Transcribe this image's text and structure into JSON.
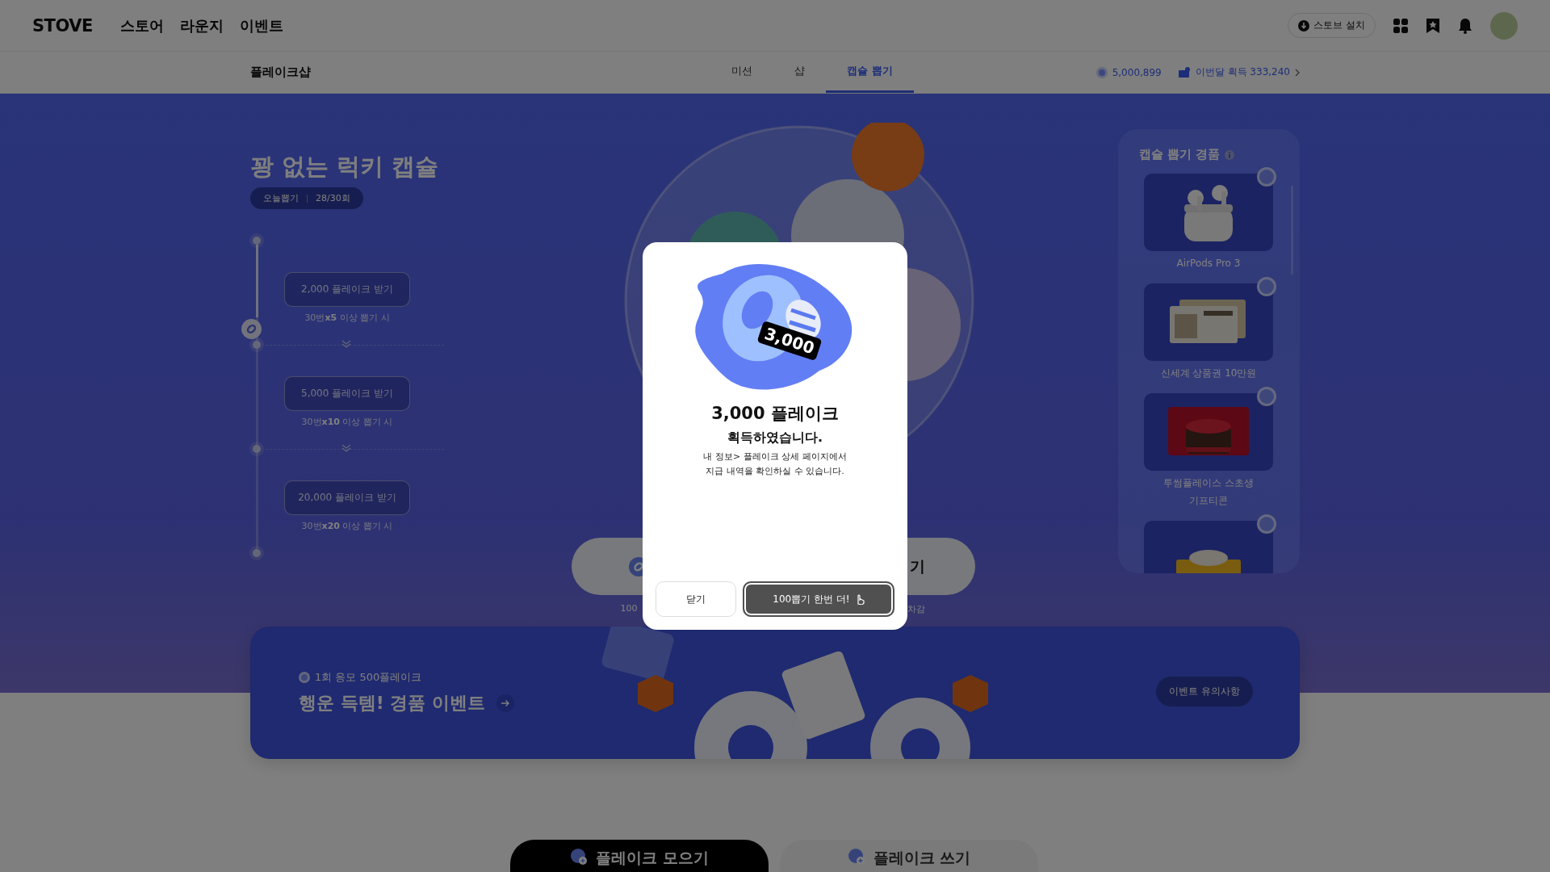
{
  "top_nav": {
    "logo": "STOVE",
    "menu": [
      "스토어",
      "라운지",
      "이벤트"
    ],
    "install_button": "스토브 설치"
  },
  "sub_nav": {
    "title": "플레이크샵",
    "tabs": [
      {
        "label": "미션",
        "selected": false
      },
      {
        "label": "샵",
        "selected": false
      },
      {
        "label": "캡슐 뽑기",
        "selected": true
      }
    ],
    "balance": "5,000,899",
    "monthly": "이번달 획득 333,240"
  },
  "hero": {
    "title": "꽝 없는 럭키 캡슐",
    "today_label": "오늘뽑기",
    "today_count": "28/30회",
    "timeline": {
      "level": 0.26,
      "milestones": [
        {
          "reward": "2,000 플레이크 받기",
          "condition": "30번**x5** 이상 뽑기 시"
        },
        {
          "reward": "5,000 플레이크 받기",
          "condition": "30번**x10** 이상 뽑기 시"
        },
        {
          "reward": "20,000 플레이크 받기",
          "condition": "30번**x20** 이상 뽑기 시"
        }
      ]
    },
    "pull_buttons": [
      {
        "caption": "100"
      },
      {
        "label": "기",
        "caption": "차감"
      }
    ]
  },
  "prizes": {
    "title": "캡슐 뽑기 경품",
    "items": [
      {
        "kind": "earbuds",
        "name": "AirPods Pro 3"
      },
      {
        "kind": "voucher",
        "name": "신세계 상품권 10만원"
      },
      {
        "kind": "cake",
        "name": "투썸플레이스 스초생 기프티콘"
      },
      {
        "kind": "cut"
      }
    ]
  },
  "banner": {
    "entry_cost": "1회 응모 500플레이크",
    "title": "행운 득템! 경품 이벤트",
    "notice_button": "이벤트 유의사항"
  },
  "bottom_tabs": [
    {
      "label": "플레이크 모으기",
      "selected": true
    },
    {
      "label": "플레이크 쓰기",
      "selected": false
    }
  ],
  "modal": {
    "badge": "3,000",
    "title": "3,000 플레이크",
    "subtitle": "획득하였습니다.",
    "description": "내 정보> 플레이크 상세 페이지에서\n지급 내역을 확인하실 수 있습니다.",
    "buttons": [
      {
        "label": "닫기",
        "kind": "secondary"
      },
      {
        "label": "100뽑기 한번 더!",
        "kind": "primary"
      }
    ]
  }
}
